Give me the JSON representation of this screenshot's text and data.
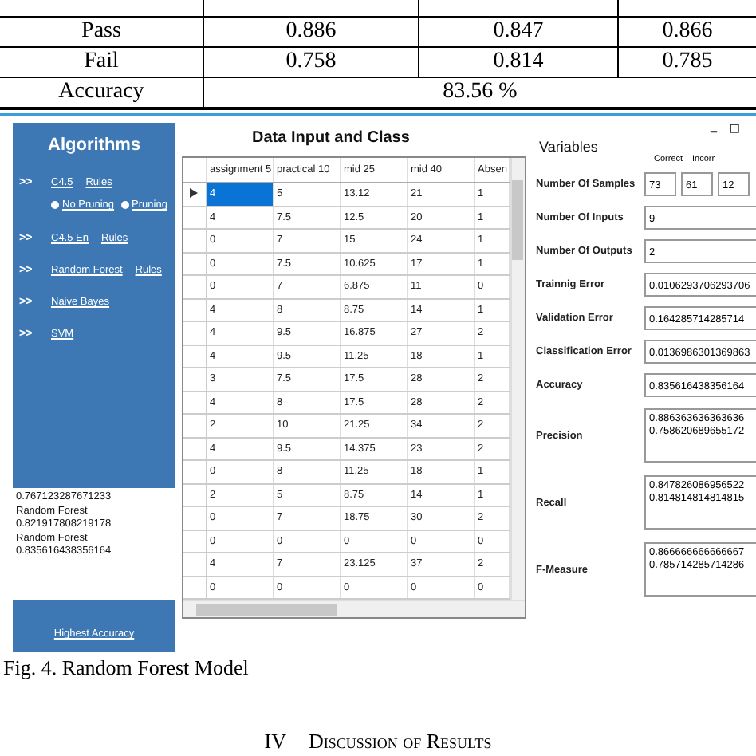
{
  "results_table": {
    "rows": [
      {
        "label": "Pass",
        "values": [
          "0.886",
          "0.847",
          "0.866"
        ]
      },
      {
        "label": "Fail",
        "values": [
          "0.758",
          "0.814",
          "0.785"
        ]
      }
    ],
    "accuracy": {
      "label": "Accuracy",
      "value": "83.56 %"
    }
  },
  "app": {
    "sidebar": {
      "title": "Algorithms",
      "items": [
        {
          "kind": "algorithm",
          "marker": ">>",
          "label": "C4.5",
          "extra": "Rules"
        },
        {
          "kind": "options",
          "options": [
            {
              "label": "No Pruning",
              "selected": false
            },
            {
              "label": "Pruning",
              "selected": false
            }
          ]
        },
        {
          "kind": "algorithm",
          "marker": ">>",
          "label": "C4.5 En",
          "extra": "Rules"
        },
        {
          "kind": "algorithm",
          "marker": ">>",
          "label": "Random Forest",
          "extra": "Rules"
        },
        {
          "kind": "algorithm",
          "marker": ">>",
          "label": "Naive Bayes"
        },
        {
          "kind": "algorithm",
          "marker": ">>",
          "label": "SVM"
        }
      ],
      "output_lines": [
        "0.767123287671233",
        "Random Forest",
        "0.821917808219178",
        "Random Forest",
        "0.835616438356164"
      ],
      "bottom_link": "Highest Accuracy"
    },
    "grid": {
      "title": "Data Input and Class",
      "columns": [
        "assignment 5",
        "practical 10",
        "mid 25",
        "mid 40",
        "Absen"
      ],
      "rows": [
        {
          "selected": true,
          "cells": [
            "4",
            "5",
            "13.12",
            "21",
            "1"
          ]
        },
        {
          "selected": false,
          "cells": [
            "4",
            "7.5",
            "12.5",
            "20",
            "1"
          ]
        },
        {
          "selected": false,
          "cells": [
            "0",
            "7",
            "15",
            "24",
            "1"
          ]
        },
        {
          "selected": false,
          "cells": [
            "0",
            "7.5",
            "10.625",
            "17",
            "1"
          ]
        },
        {
          "selected": false,
          "cells": [
            "0",
            "7",
            "6.875",
            "11",
            "0"
          ]
        },
        {
          "selected": false,
          "cells": [
            "4",
            "8",
            "8.75",
            "14",
            "1"
          ]
        },
        {
          "selected": false,
          "cells": [
            "4",
            "9.5",
            "16.875",
            "27",
            "2"
          ]
        },
        {
          "selected": false,
          "cells": [
            "4",
            "9.5",
            "11.25",
            "18",
            "1"
          ]
        },
        {
          "selected": false,
          "cells": [
            "3",
            "7.5",
            "17.5",
            "28",
            "2"
          ]
        },
        {
          "selected": false,
          "cells": [
            "4",
            "8",
            "17.5",
            "28",
            "2"
          ]
        },
        {
          "selected": false,
          "cells": [
            "2",
            "10",
            "21.25",
            "34",
            "2"
          ]
        },
        {
          "selected": false,
          "cells": [
            "4",
            "9.5",
            "14.375",
            "23",
            "2"
          ]
        },
        {
          "selected": false,
          "cells": [
            "0",
            "8",
            "11.25",
            "18",
            "1"
          ]
        },
        {
          "selected": false,
          "cells": [
            "2",
            "5",
            "8.75",
            "14",
            "1"
          ]
        },
        {
          "selected": false,
          "cells": [
            "0",
            "7",
            "18.75",
            "30",
            "2"
          ]
        },
        {
          "selected": false,
          "cells": [
            "0",
            "0",
            "0",
            "0",
            "0"
          ]
        },
        {
          "selected": false,
          "cells": [
            "4",
            "7",
            "23.125",
            "37",
            "2"
          ]
        },
        {
          "selected": false,
          "cells": [
            "0",
            "0",
            "0",
            "0",
            "0"
          ]
        }
      ]
    },
    "variables": {
      "title": "Variables",
      "column_headers": [
        "Correct",
        "Incorr"
      ],
      "fields": [
        {
          "kind": "boxes",
          "label": "Number Of Samples",
          "values": [
            "73",
            "61",
            "12"
          ]
        },
        {
          "kind": "boxes",
          "label": "Number Of Inputs",
          "values": [
            "9"
          ]
        },
        {
          "kind": "boxes",
          "label": "Number Of Outputs",
          "values": [
            "2"
          ]
        },
        {
          "kind": "boxes",
          "label": "Trainnig Error",
          "values": [
            "0.0106293706293706"
          ]
        },
        {
          "kind": "boxes",
          "label": "Validation Error",
          "values": [
            "0.164285714285714"
          ]
        },
        {
          "kind": "boxes",
          "label": "Classification Error",
          "values": [
            "0.0136986301369863"
          ]
        },
        {
          "kind": "boxes",
          "label": "Accuracy",
          "values": [
            "0.835616438356164"
          ]
        },
        {
          "kind": "multiline",
          "label": "Precision",
          "values": [
            "0.886363636363636",
            "0.758620689655172"
          ]
        },
        {
          "kind": "multiline",
          "label": "Recall",
          "values": [
            "0.847826086956522",
            "0.814814814814815"
          ]
        },
        {
          "kind": "multiline",
          "label": "F-Measure",
          "values": [
            "0.866666666666667",
            "0.785714285714286"
          ]
        }
      ]
    }
  },
  "caption": "Fig. 4. Random Forest Model",
  "section_heading": {
    "number": "IV",
    "title": "Discussion of Results"
  }
}
